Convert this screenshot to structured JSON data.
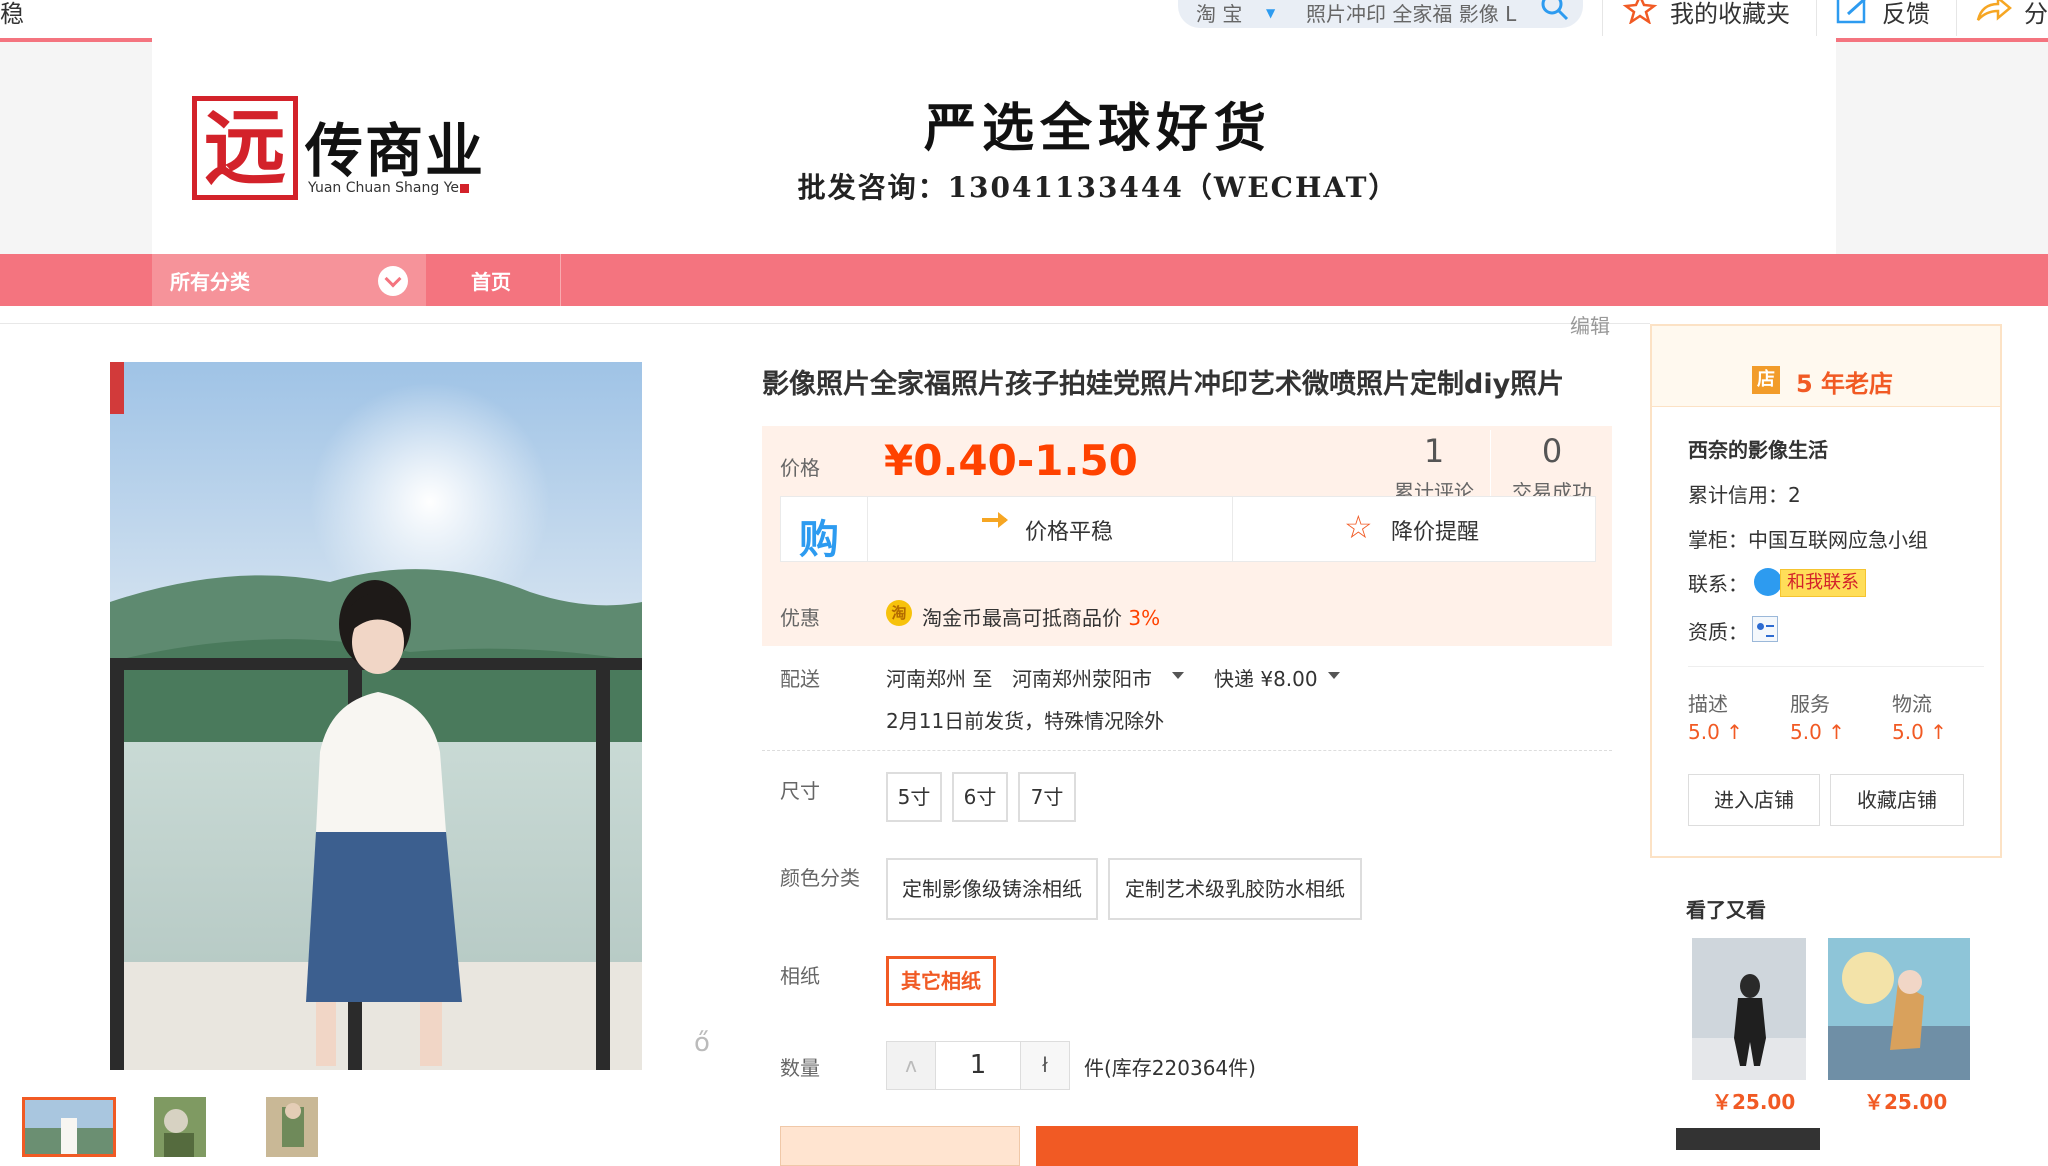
{
  "topbar": {
    "left_fragment": "稳",
    "search_scope": "淘  宝",
    "search_query": "照片冲印 全家福 影像 L",
    "favorites_label": "我的收藏夹",
    "feedback_label": "反馈",
    "share_fragment": "分"
  },
  "header": {
    "logo_char": "远",
    "logo_title": "传商业",
    "logo_subtitle": "Yuan Chuan Shang Ye",
    "slogan": "严选全球好货",
    "contact": "批发咨询：13041133444（WECHAT）"
  },
  "nav": {
    "all_categories": "所有分类",
    "home": "首页"
  },
  "gallery": {
    "watermark": "ő"
  },
  "product": {
    "edit_label": "编辑",
    "title": "影像照片全家福照片孩子拍娃党照片冲印艺术微喷照片定制diy照片",
    "price_label": "价格",
    "price": "¥0.40-1.50",
    "reviews_count": "1",
    "reviews_label": "累计评论",
    "deals_count": "0",
    "deals_label": "交易成功",
    "buy_icon_char": "购",
    "price_trend": "价格平稳",
    "price_drop_alert": "降价提醒",
    "discount_label": "优惠",
    "coin_char": "淘",
    "discount_text": "淘金币最高可抵商品价",
    "discount_pct": "3%",
    "shipping_label": "配送",
    "ship_from": "河南郑州 至",
    "ship_to": "河南郑州荥阳市",
    "ship_method": "快递 ¥8.00",
    "ship_date": "2月11日前发货，特殊情况除外",
    "size_label": "尺寸",
    "sizes": [
      "5寸",
      "6寸",
      "7寸"
    ],
    "color_label": "颜色分类",
    "colors": [
      "定制影像级铸涂相纸",
      "定制艺术级乳胶防水相纸"
    ],
    "paper_label": "相纸",
    "paper_option": "其它相纸",
    "qty_label": "数量",
    "qty_minus": "ʌ",
    "qty_value": "1",
    "qty_plus": "ł",
    "stock_text": "件(库存220364件)"
  },
  "shop": {
    "badge_char": "店",
    "years": "5 年老店",
    "name": "西奈的影像生活",
    "credit": "累计信用：2",
    "keeper": "掌柜：中国互联网应急小组",
    "contact_label": "联系：",
    "contact_button": "和我联系",
    "cert_label": "资质：",
    "ratings": [
      {
        "label": "描述",
        "value": "5.0 ↑"
      },
      {
        "label": "服务",
        "value": "5.0 ↑"
      },
      {
        "label": "物流",
        "value": "5.0 ↑"
      }
    ],
    "enter_shop": "进入店铺",
    "fav_shop": "收藏店铺"
  },
  "also_viewed": {
    "title": "看了又看",
    "items": [
      {
        "price": "￥25.00"
      },
      {
        "price": "￥25.00"
      }
    ]
  }
}
